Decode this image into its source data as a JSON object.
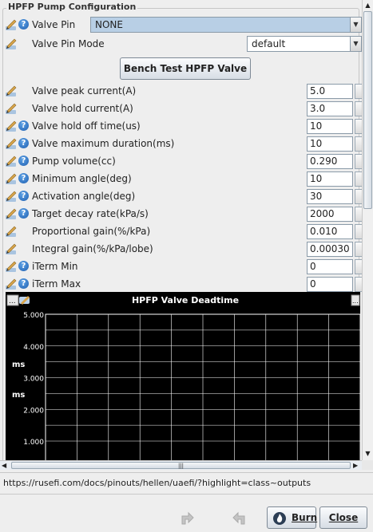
{
  "group_title": "HPFP Pump Configuration",
  "valve_pin": {
    "label": "Valve Pin",
    "value": "NONE"
  },
  "valve_pin_mode": {
    "label": "Valve Pin Mode",
    "value": "default"
  },
  "bench_test_label": "Bench Test HPFP Valve",
  "fields": [
    {
      "label": "Valve peak current(A)",
      "value": "5.0",
      "help": false
    },
    {
      "label": "Valve hold current(A)",
      "value": "3.0",
      "help": false
    },
    {
      "label": "Valve hold off time(us)",
      "value": "10",
      "help": true
    },
    {
      "label": "Valve maximum duration(ms)",
      "value": "10",
      "help": true
    },
    {
      "label": "Pump volume(cc)",
      "value": "0.290",
      "help": true
    },
    {
      "label": "Minimum angle(deg)",
      "value": "10",
      "help": true
    },
    {
      "label": "Activation angle(deg)",
      "value": "30",
      "help": true
    },
    {
      "label": "Target decay rate(kPa/s)",
      "value": "2000",
      "help": true
    },
    {
      "label": "Proportional gain(%/kPa)",
      "value": "0.010",
      "help": false
    },
    {
      "label": "Integral gain(%/kPa/lobe)",
      "value": "0.00030",
      "help": false
    },
    {
      "label": "iTerm Min",
      "value": "0",
      "help": true
    },
    {
      "label": "iTerm Max",
      "value": "0",
      "help": true
    }
  ],
  "help_glyph": "?",
  "menu_glyph": "...",
  "chart_data": {
    "type": "line",
    "title": "HPFP Valve Deadtime",
    "ylabel": "ms",
    "ylabel2": "ms",
    "y_ticks": [
      "5.000",
      "4.000",
      "3.000",
      "2.000",
      "1.000"
    ],
    "ylim": [
      1.0,
      5.0
    ],
    "grid": true,
    "background": "#000000",
    "grid_color": "#ffffff",
    "series": []
  },
  "scroll_handle": "|||",
  "status_url": "https://rusefi.com/docs/pinouts/hellen/uaefi/?highlight=class~outputs",
  "buttons": {
    "burn": "Burn",
    "close": "Close"
  },
  "colors": {
    "pin_dropdown_bg": "#b8cfe5",
    "panel_bg": "#eeeeee",
    "chart_bg": "#000000"
  }
}
